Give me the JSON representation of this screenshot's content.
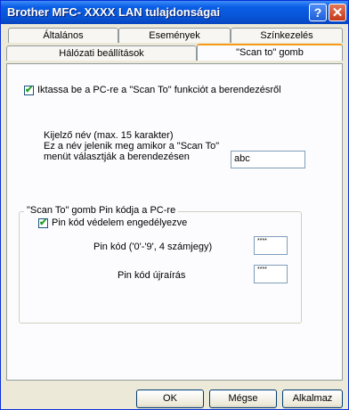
{
  "window": {
    "title": "Brother MFC-  XXXX  LAN tulajdonságai",
    "help_label": "?",
    "close_label": "✕"
  },
  "tabs": {
    "row1": [
      "Általános",
      "Események",
      "Színkezelés"
    ],
    "row2": [
      "Hálózati beállítások",
      "\"Scan to\" gomb"
    ],
    "active": "\"Scan to\" gomb"
  },
  "scan_to": {
    "enable_checkbox": {
      "label": "Iktassa be a PC-re a \"Scan To\" funkciót a berendezésről",
      "checked": true
    },
    "display_name": {
      "line1": "Kijelző név (max. 15 karakter)",
      "line2": "Ez a név jelenik meg amikor a \"Scan To\"",
      "line3": "menüt választják a berendezésen",
      "value": "abc"
    },
    "pin_group": {
      "title": "\"Scan To\" gomb Pin kódja a PC-re",
      "protect_checkbox": {
        "label": "Pin kód védelem engedélyezve",
        "checked": true
      },
      "pin_label": "Pin kód ('0'-'9', 4 számjegy)",
      "pin_value": "****",
      "retype_label": "Pin kód újraírás",
      "retype_value": "****"
    }
  },
  "buttons": {
    "ok": "OK",
    "cancel": "Mégse",
    "apply": "Alkalmaz"
  }
}
